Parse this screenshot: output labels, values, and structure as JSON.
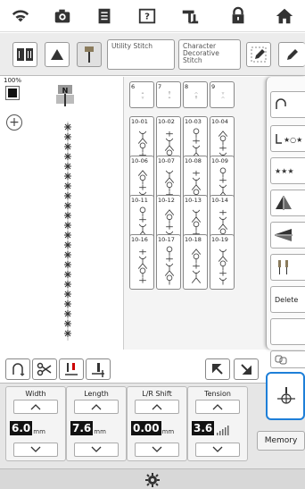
{
  "top_icons": [
    "wifi-icon",
    "camera-icon",
    "document-icon",
    "help-icon",
    "sewing-machine-icon",
    "lock-icon",
    "home-icon"
  ],
  "tabs": {
    "utility": "Utility Stitch",
    "character": "Character Decorative Stitch"
  },
  "preview": {
    "zoom": "100%",
    "foot": "N"
  },
  "grid": {
    "rows": [
      [
        "6",
        "7",
        "8",
        "9"
      ],
      [
        "10-01",
        "10-02",
        "10-03",
        "10-04"
      ],
      [
        "10-06",
        "10-07",
        "10-08",
        "10-09"
      ],
      [
        "10-11",
        "10-12",
        "10-13",
        "10-14"
      ],
      [
        "10-16",
        "10-17",
        "10-18",
        "10-19"
      ]
    ]
  },
  "right_panel": {
    "delete": "Delete",
    "memory": "Memory"
  },
  "controls": [
    {
      "title": "Width",
      "value": "6.0",
      "unit": "mm"
    },
    {
      "title": "Length",
      "value": "7.6",
      "unit": "mm"
    },
    {
      "title": "L/R Shift",
      "value": "0.00",
      "unit": "mm"
    },
    {
      "title": "Tension",
      "value": "3.6",
      "unit": ""
    }
  ],
  "colors": {
    "accent": "#1e7fd8",
    "panel": "#ececec"
  }
}
